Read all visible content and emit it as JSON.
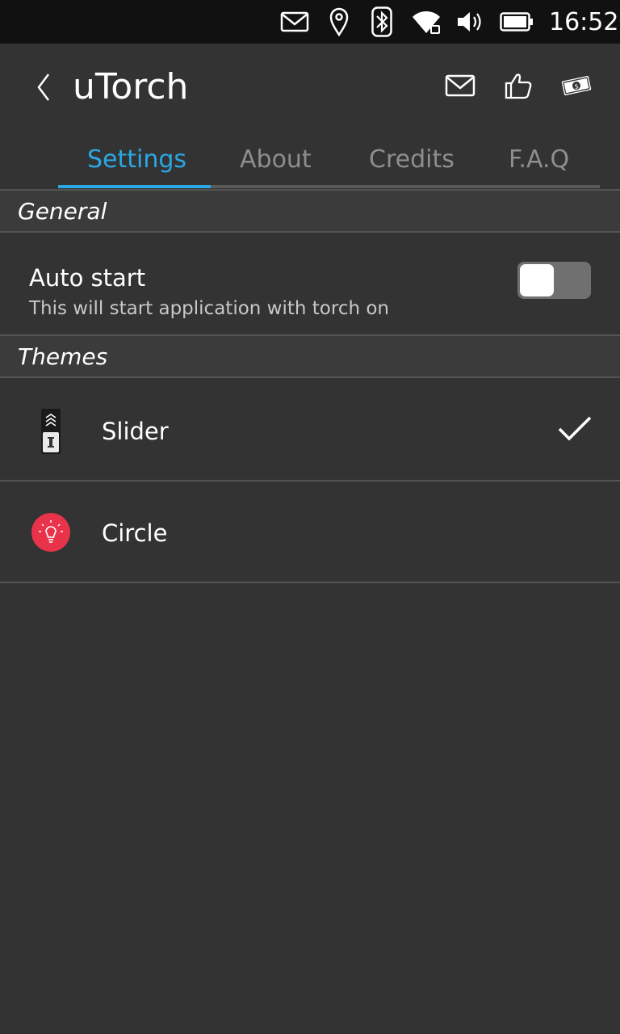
{
  "status_bar": {
    "icons": [
      "mail-icon",
      "location-icon",
      "bluetooth-icon",
      "wifi-icon",
      "volume-icon",
      "battery-icon"
    ],
    "time": "16:52"
  },
  "header": {
    "title": "uTorch",
    "actions": [
      "mail-icon",
      "thumbs-up-icon",
      "donate-icon"
    ]
  },
  "tabs": [
    {
      "label": "Settings",
      "active": true
    },
    {
      "label": "About",
      "active": false
    },
    {
      "label": "Credits",
      "active": false
    },
    {
      "label": "F.A.Q",
      "active": false
    }
  ],
  "sections": {
    "general": {
      "title": "General",
      "auto_start": {
        "title": "Auto start",
        "subtitle": "This will start application with torch on",
        "enabled": false
      }
    },
    "themes": {
      "title": "Themes",
      "items": [
        {
          "label": "Slider",
          "icon": "slider-theme-icon",
          "selected": true
        },
        {
          "label": "Circle",
          "icon": "circle-bulb-icon",
          "selected": false
        }
      ]
    }
  },
  "colors": {
    "background": "#333333",
    "status_bar": "#111111",
    "accent": "#2aa8e3",
    "section_header": "#3b3b3b",
    "divider": "#545454",
    "circle_theme": "#e8334a"
  }
}
